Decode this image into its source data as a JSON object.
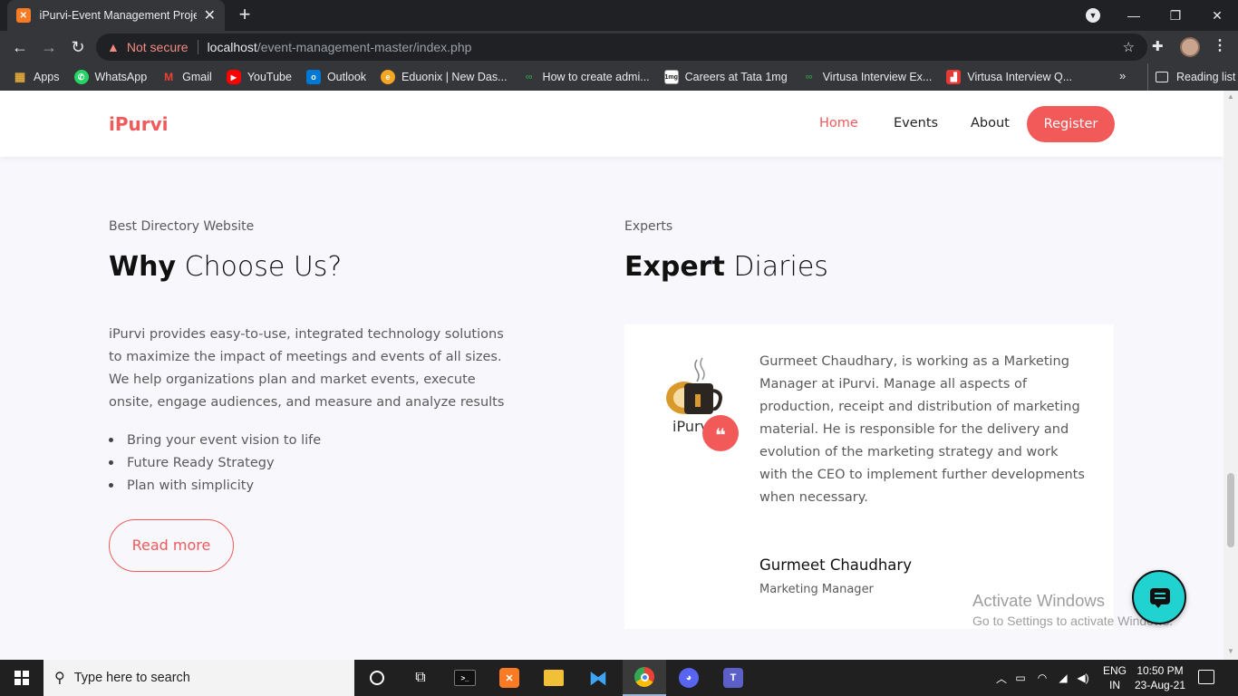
{
  "browser": {
    "tab_title": "iPurvi-Event Management Project",
    "tab_close": "✕",
    "new_tab": "+",
    "security_label": "Not secure",
    "url_host": "localhost",
    "url_path": "/event-management-master/index.php",
    "bookmarks": [
      {
        "label": "Apps",
        "icon": "apps-grid-icon",
        "color": "#4285f4"
      },
      {
        "label": "WhatsApp",
        "icon": "whatsapp-icon",
        "color": "#25d366"
      },
      {
        "label": "Gmail",
        "icon": "gmail-icon",
        "color": "#ea4335"
      },
      {
        "label": "YouTube",
        "icon": "youtube-icon",
        "color": "#ff0000"
      },
      {
        "label": "Outlook",
        "icon": "outlook-icon",
        "color": "#0078d4"
      },
      {
        "label": "Eduonix | New Das...",
        "icon": "eduonix-icon",
        "color": "#f5a623"
      },
      {
        "label": "How to create admi...",
        "icon": "geeksforgeeks-icon",
        "color": "#2f8d46"
      },
      {
        "label": "Careers at Tata 1mg",
        "icon": "tata1mg-icon",
        "color": "#ff6f61"
      },
      {
        "label": "Virtusa Interview Ex...",
        "icon": "geeksforgeeks-icon",
        "color": "#2f8d46"
      },
      {
        "label": "Virtusa Interview Q...",
        "icon": "virtusa-icon",
        "color": "#e53935"
      }
    ],
    "bookmarks_more": "»",
    "reading_list": "Reading list"
  },
  "site": {
    "logo": "iPurvi",
    "nav": [
      "Home",
      "Events",
      "About"
    ],
    "register": "Register",
    "accent_color": "#f25a5a"
  },
  "why": {
    "eyebrow": "Best Directory Website",
    "title_bold": "Why",
    "title_rest": " Choose Us?",
    "paragraph": "iPurvi provides easy-to-use, integrated technology solutions to maximize the impact of meetings and events of all sizes. We help organizations plan and market events, execute onsite, engage audiences, and measure and analyze results",
    "bullets": [
      "Bring your event vision to life",
      "Future Ready Strategy",
      "Plan with simplicity"
    ],
    "read_more": "Read more"
  },
  "experts": {
    "eyebrow": "Experts",
    "title_bold": "Expert",
    "title_rest": " Diaries",
    "image_caption": "iPurvi",
    "quote_mark": "❝",
    "text": "Gurmeet Chaudhary, is working as a Marketing Manager at iPurvi. Manage all aspects of production, receipt and distribution of marketing material. He is responsible for the delivery and evolution of the marketing strategy and work with the CEO to implement further developments when necessary.",
    "name": "Gurmeet Chaudhary",
    "role": "Marketing Manager"
  },
  "watermark": {
    "line1": "Activate Windows",
    "line2": "Go to Settings to activate Windows."
  },
  "taskbar": {
    "search_placeholder": "Type here to search",
    "lang_top": "ENG",
    "lang_bottom": "IN",
    "time": "10:50 PM",
    "date": "23-Aug-21"
  }
}
